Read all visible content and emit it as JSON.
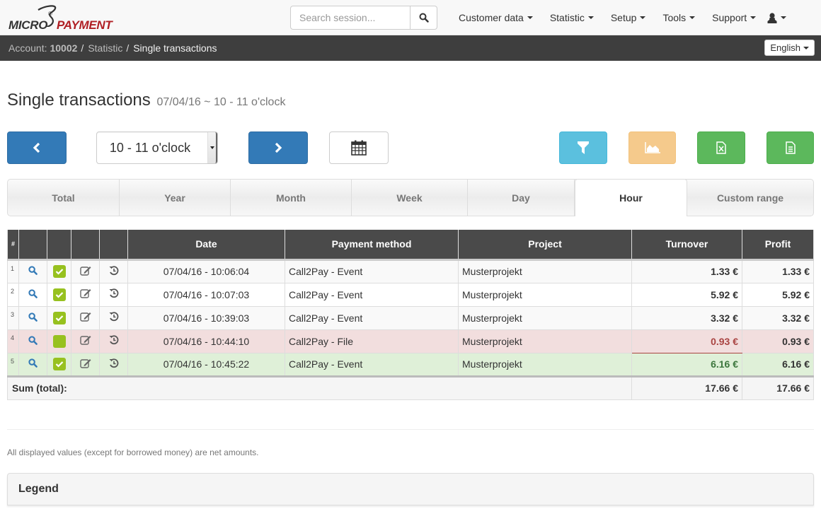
{
  "brand": {
    "part1": "MICRO",
    "part2": "PAYMENT",
    "registered": "®"
  },
  "search": {
    "placeholder": "Search session...",
    "value": ""
  },
  "nav": {
    "items": [
      {
        "label": "Customer data"
      },
      {
        "label": "Statistic"
      },
      {
        "label": "Setup"
      },
      {
        "label": "Tools"
      },
      {
        "label": "Support"
      }
    ]
  },
  "breadcrumb": {
    "account_label": "Account:",
    "account_number": "10002",
    "separator": "/",
    "statistic": "Statistic",
    "current": "Single transactions"
  },
  "language": {
    "selected": "English"
  },
  "page": {
    "title": "Single transactions",
    "subtitle": "07/04/16  ~  10 - 11 o'clock"
  },
  "controls": {
    "hour_select": "10 - 11 o'clock"
  },
  "tabs": [
    {
      "label": "Total",
      "active": false
    },
    {
      "label": "Year",
      "active": false
    },
    {
      "label": "Month",
      "active": false
    },
    {
      "label": "Week",
      "active": false
    },
    {
      "label": "Day",
      "active": false
    },
    {
      "label": "Hour",
      "active": true
    },
    {
      "label": "Custom range",
      "active": false
    }
  ],
  "table": {
    "headers": {
      "index": "#",
      "date": "Date",
      "payment_method": "Payment method",
      "project": "Project",
      "turnover": "Turnover",
      "profit": "Profit"
    },
    "rows": [
      {
        "index": "1",
        "checked": true,
        "date": "07/04/16 - 10:06:04",
        "payment_method": "Call2Pay - Event",
        "project": "Musterprojekt",
        "turnover": "1.33 €",
        "profit": "1.33 €",
        "status": "normal"
      },
      {
        "index": "2",
        "checked": true,
        "date": "07/04/16 - 10:07:03",
        "payment_method": "Call2Pay - Event",
        "project": "Musterprojekt",
        "turnover": "5.92 €",
        "profit": "5.92 €",
        "status": "normal"
      },
      {
        "index": "3",
        "checked": true,
        "date": "07/04/16 - 10:39:03",
        "payment_method": "Call2Pay - Event",
        "project": "Musterprojekt",
        "turnover": "3.32 €",
        "profit": "3.32 €",
        "status": "normal"
      },
      {
        "index": "4",
        "checked": false,
        "date": "07/04/16 - 10:44:10",
        "payment_method": "Call2Pay - File",
        "project": "Musterprojekt",
        "turnover": "0.93 €",
        "profit": "0.93 €",
        "status": "danger"
      },
      {
        "index": "5",
        "checked": true,
        "date": "07/04/16 - 10:45:22",
        "payment_method": "Call2Pay - Event",
        "project": "Musterprojekt",
        "turnover": "6.16 €",
        "profit": "6.16 €",
        "status": "success"
      }
    ],
    "sum": {
      "label": "Sum (total):",
      "turnover": "17.66 €",
      "profit": "17.66 €"
    }
  },
  "footer": {
    "note": "All displayed values (except for borrowed money) are net amounts.",
    "legend_title": "Legend"
  },
  "colors": {
    "primary": "#337ab7",
    "info": "#5bc0de",
    "warning": "#f5ca8c",
    "success": "#5cb85c",
    "checkbox": "#97c11f",
    "danger_text": "#a94442",
    "success_text": "#3c763d",
    "brand_red": "#b01f24"
  }
}
